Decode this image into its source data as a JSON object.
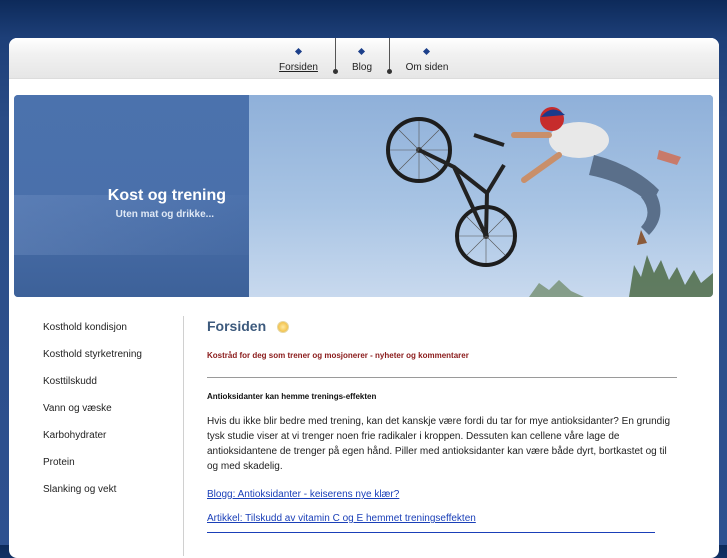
{
  "nav": {
    "items": [
      {
        "label": "Forsiden",
        "active": true
      },
      {
        "label": "Blog",
        "active": false
      },
      {
        "label": "Om siden",
        "active": false
      }
    ]
  },
  "header": {
    "title": "Kost og trening",
    "subtitle": "Uten mat og drikke..."
  },
  "sidebar": {
    "items": [
      {
        "label": "Kosthold kondisjon"
      },
      {
        "label": "Kosthold styrketrening"
      },
      {
        "label": "Kosttilskudd"
      },
      {
        "label": "Vann og væske"
      },
      {
        "label": "Karbohydrater"
      },
      {
        "label": "Protein"
      },
      {
        "label": "Slanking og vekt"
      }
    ]
  },
  "main": {
    "title": "Forsiden",
    "tagline": "Kostråd for deg som trener og mosjonerer - nyheter og kommentarer",
    "article": {
      "headline": "Antioksidanter kan hemme trenings-effekten",
      "body": "Hvis du ikke blir bedre med trening, kan det kanskje være fordi du tar for mye antioksidanter? En grundig tysk studie viser at vi trenger noen frie radikaler i kroppen. Dessuten kan cellene våre lage de antioksidantene de trenger på egen hånd. Piller med antioksidanter kan være både dyrt, bortkastet og til og med skadelig."
    },
    "links": [
      {
        "label": "Blogg: Antioksidanter - keiserens nye klær?"
      },
      {
        "label": "Artikkel: Tilskudd av vitamin C og E hemmet treningseffekten"
      }
    ]
  },
  "colors": {
    "background": "#1d3f78",
    "banner": "#4b72ad",
    "link": "#1a3fb8",
    "tagline": "#8a1a1a",
    "title": "#3d5a7d"
  }
}
